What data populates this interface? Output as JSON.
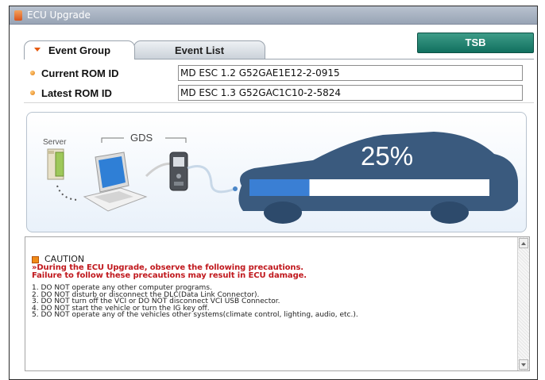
{
  "window": {
    "title": "ECU Upgrade"
  },
  "tabs": [
    {
      "label": "Event Group",
      "active": true
    },
    {
      "label": "Event List",
      "active": false
    }
  ],
  "tsb_button": {
    "label": "TSB"
  },
  "rom": {
    "current_label": "Current ROM ID",
    "current_value": "MD ESC    1.2  G52GAE1E12-2-0915",
    "latest_label": "Latest ROM ID",
    "latest_value": "MD ESC    1.3  G52GAC1C10-2-5824"
  },
  "diagram": {
    "server_label": "Server",
    "gds_label": "GDS",
    "progress_text": "25%",
    "progress_fraction": 0.25,
    "car_color": "#3a5a7e",
    "progress_color": "#3a7fd4"
  },
  "caution": {
    "title": "CAUTION",
    "warning_line1": "»During the ECU Upgrade, observe the following precautions.",
    "warning_line2": "Failure to follow these precautions may result in ECU damage.",
    "rules": [
      "1. DO NOT operate any other computer programs.",
      "2. DO NOT disturb or disconnect the DLC(Data Link Connector).",
      "3. DO NOT turn off the VCI or DO NOT disconnect VCI USB Connector.",
      "4. DO NOT start the vehicle or turn the IG key off.",
      "5. DO NOT operate any of the vehicles other systems(climate control, lighting, audio, etc.)."
    ]
  }
}
